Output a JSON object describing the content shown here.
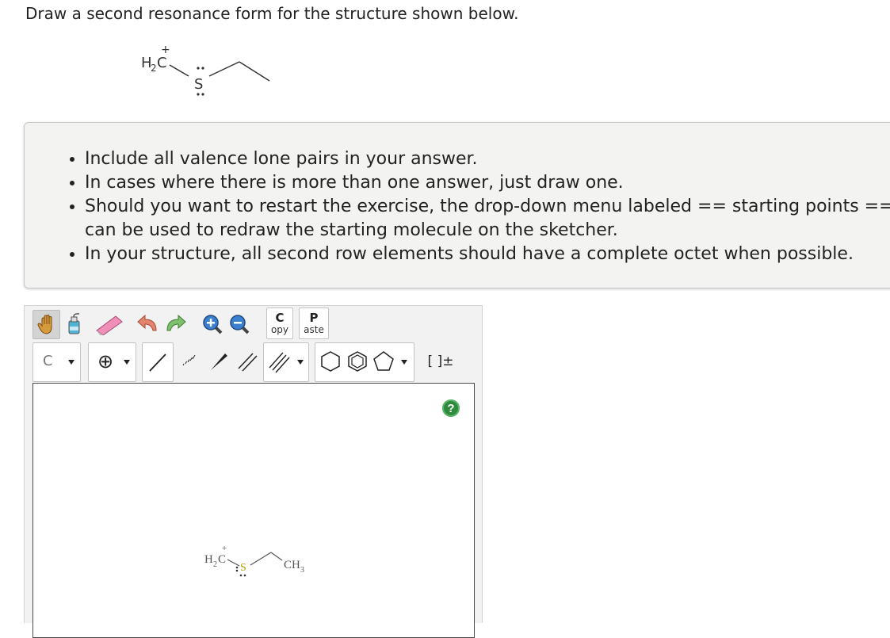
{
  "question": {
    "prompt": "Draw a second resonance form for the structure shown below.",
    "molecule": {
      "ch2_label": "H",
      "ch2_sub": "2",
      "carbon_label": "C",
      "carbon_charge": "+",
      "sulfur_label": "S"
    }
  },
  "instructions": [
    "Include all valence lone pairs in your answer.",
    "In cases where there is more than one answer, just draw one.",
    "Should you want to restart the exercise, the drop-down menu labeled == starting points == can be used to redraw the starting molecule on the sketcher.",
    "In your structure, all second row elements should have a complete octet when possible."
  ],
  "toolbar": {
    "copy_top": "C",
    "copy_bottom": "opy",
    "paste_top": "P",
    "paste_bottom": "aste",
    "element_select": "C",
    "charge_symbol": "⊕",
    "bracket_label": "[ ]±"
  },
  "canvas": {
    "help_label": "?",
    "molecule": {
      "ch2_label": "H",
      "ch2_sub": "2",
      "carbon_label": "C",
      "carbon_charge": "+",
      "sulfur_label": "S",
      "ch3_label": "CH",
      "ch3_sub": "3"
    }
  },
  "colors": {
    "sulfur": "#b5a000",
    "help": "#2e8b3e",
    "panel_bg": "#f3f3f1"
  }
}
